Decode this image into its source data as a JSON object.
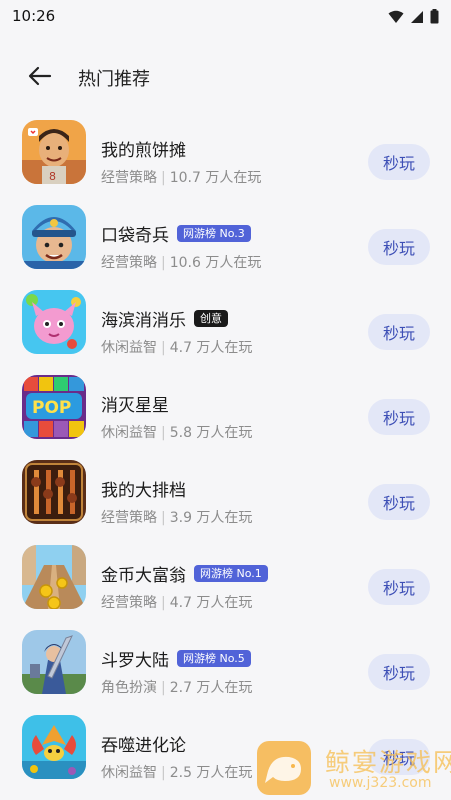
{
  "status_bar": {
    "time": "10:26"
  },
  "header": {
    "title": "热门推荐",
    "back_icon": "arrow-left-icon"
  },
  "games": [
    {
      "name": "我的煎饼摊",
      "badge": "",
      "badge_type": "",
      "category": "经营策略",
      "players": "10.7 万人在玩",
      "button": "秒玩",
      "icon": "pancake-vendor-icon"
    },
    {
      "name": "口袋奇兵",
      "badge": "网游榜 No.3",
      "badge_type": "rank",
      "category": "经营策略",
      "players": "10.6 万人在玩",
      "button": "秒玩",
      "icon": "soldier-icon"
    },
    {
      "name": "海滨消消乐",
      "badge": "创意",
      "badge_type": "creative",
      "category": "休闲益智",
      "players": "4.7 万人在玩",
      "button": "秒玩",
      "icon": "pink-creature-icon"
    },
    {
      "name": "消灭星星",
      "badge": "",
      "badge_type": "",
      "category": "休闲益智",
      "players": "5.8 万人在玩",
      "button": "秒玩",
      "icon": "pop-star-icon"
    },
    {
      "name": "我的大排档",
      "badge": "",
      "badge_type": "",
      "category": "经营策略",
      "players": "3.9 万人在玩",
      "button": "秒玩",
      "icon": "grill-food-icon"
    },
    {
      "name": "金币大富翁",
      "badge": "网游榜 No.1",
      "badge_type": "rank",
      "category": "经营策略",
      "players": "4.7 万人在玩",
      "button": "秒玩",
      "icon": "gold-coin-road-icon"
    },
    {
      "name": "斗罗大陆",
      "badge": "网游榜 No.5",
      "badge_type": "rank",
      "category": "角色扮演",
      "players": "2.7 万人在玩",
      "button": "秒玩",
      "icon": "warrior-icon"
    },
    {
      "name": "吞噬进化论",
      "badge": "",
      "badge_type": "",
      "category": "休闲益智",
      "players": "2.5 万人在玩",
      "button": "秒玩",
      "icon": "sea-creature-icon"
    }
  ],
  "watermark": {
    "text": "鲸宴游戏网",
    "url": "www.j323.com"
  },
  "colors": {
    "rank_badge": "#5163d8",
    "creative_badge": "#1a1a1a",
    "play_button_bg": "#e3e7f7",
    "play_button_text": "#3d4fb6"
  }
}
